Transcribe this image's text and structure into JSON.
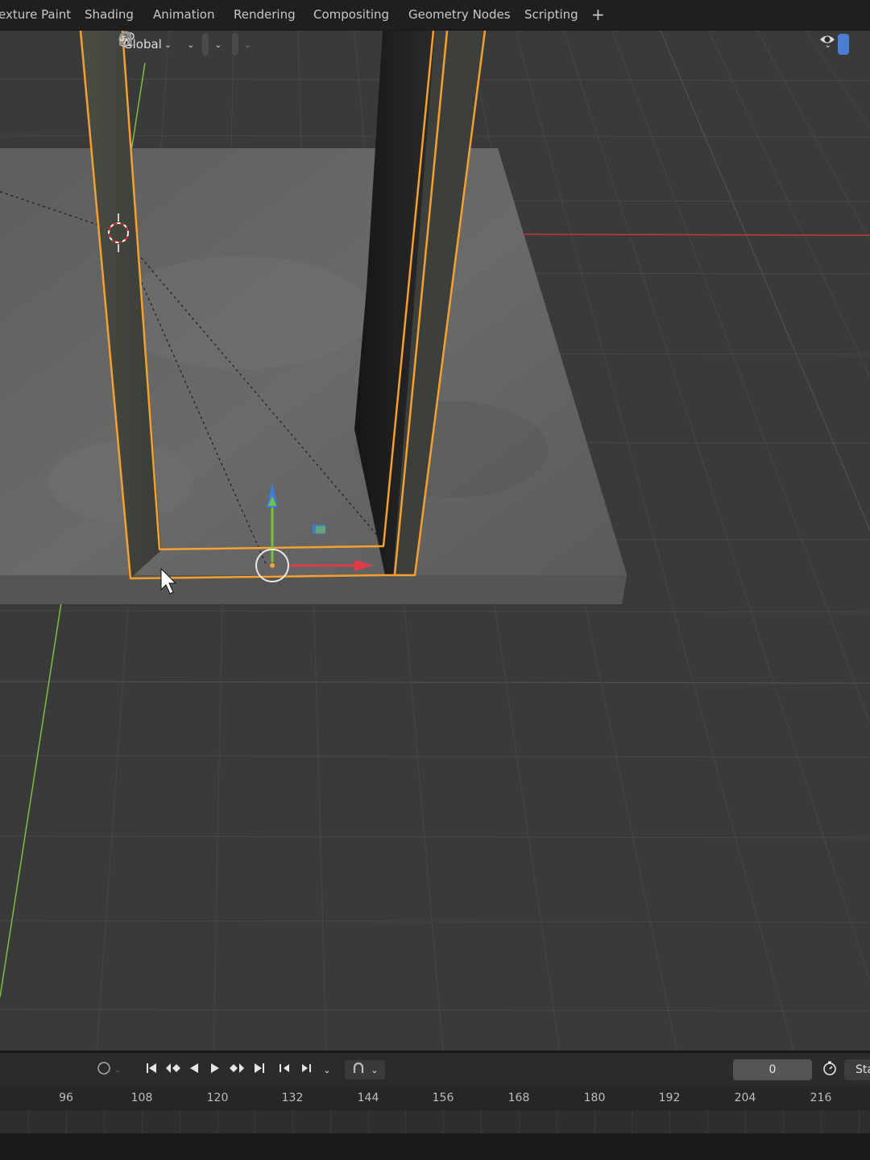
{
  "workspace_tabs": [
    {
      "label": "exture Paint"
    },
    {
      "label": "Shading"
    },
    {
      "label": "Animation"
    },
    {
      "label": "Rendering"
    },
    {
      "label": "Compositing"
    },
    {
      "label": "Geometry Nodes"
    },
    {
      "label": "Scripting"
    }
  ],
  "add_workspace_label": "+",
  "viewport_header": {
    "transform_orientation": "Global"
  },
  "timeline": {
    "current_frame": "0",
    "start_label": "Sta",
    "ruler_ticks": [
      "96",
      "108",
      "120",
      "132",
      "144",
      "156",
      "168",
      "180",
      "192",
      "204",
      "216"
    ]
  },
  "colors": {
    "selection_outline": "#f5a030",
    "x_axis": "#c8363e",
    "y_axis": "#7ac043",
    "gizmo_z": "#3a7fe0"
  }
}
